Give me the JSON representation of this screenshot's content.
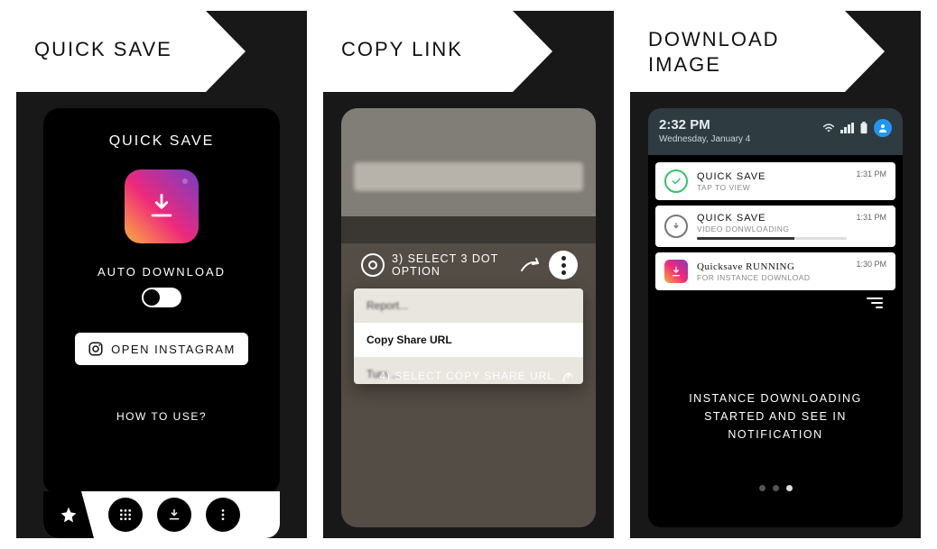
{
  "panel1": {
    "banner": "QUICK SAVE",
    "title": "QUICK SAVE",
    "auto_label": "AUTO DOWNLOAD",
    "open_btn": "OPEN INSTAGRAM",
    "how_to": "HOW TO USE?"
  },
  "panel2": {
    "banner": "COPY LINK",
    "step3": "3) SELECT 3 DOT OPTION",
    "menu": {
      "report": "Report...",
      "copy": "Copy Share URL",
      "turn": "Turn ..."
    },
    "step4": "4) SELECT COPY SHARE URL"
  },
  "panel3": {
    "banner_l1": "DOWNLOAD",
    "banner_l2": "IMAGE",
    "status": {
      "time": "2:32 PM",
      "date": "Wednesday, January 4"
    },
    "notifs": {
      "n1": {
        "title": "QUICK SAVE",
        "sub": "TAP TO VIEW",
        "ts": "1:31 PM"
      },
      "n2": {
        "title": "QUICK SAVE",
        "sub": "VIDEO DONWLOADING",
        "ts": "1:31 PM"
      },
      "n3": {
        "title": "Quicksave RUNNING",
        "sub": "FOR INSTANCE DOWNLOAD",
        "ts": "1:30 PM"
      }
    },
    "body": "INSTANCE DOWNLOADING STARTED AND SEE IN NOTIFICATION"
  }
}
